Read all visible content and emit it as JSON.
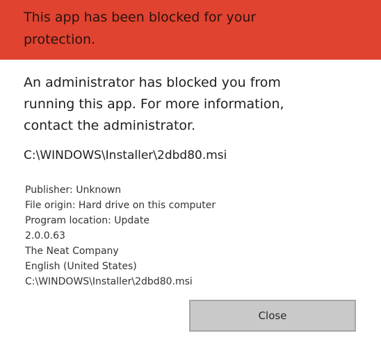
{
  "header": {
    "title": "This app has been blocked for your protection."
  },
  "message": "An administrator has blocked you from running this app. For more information, contact the administrator.",
  "file_path": "C:\\WINDOWS\\Installer\\2dbd80.msi",
  "details": {
    "publisher": "Publisher: Unknown",
    "file_origin": "File origin: Hard drive on this computer",
    "program_location": "Program location: Update",
    "version": "2.0.0.63",
    "company": "The Neat Company",
    "language": "English (United States)",
    "path": "C:\\WINDOWS\\Installer\\2dbd80.msi"
  },
  "buttons": {
    "close_label": "Close"
  },
  "colors": {
    "header_background": "#e0432f",
    "dialog_background": "#ffffff",
    "button_background": "#c9c9c9"
  }
}
